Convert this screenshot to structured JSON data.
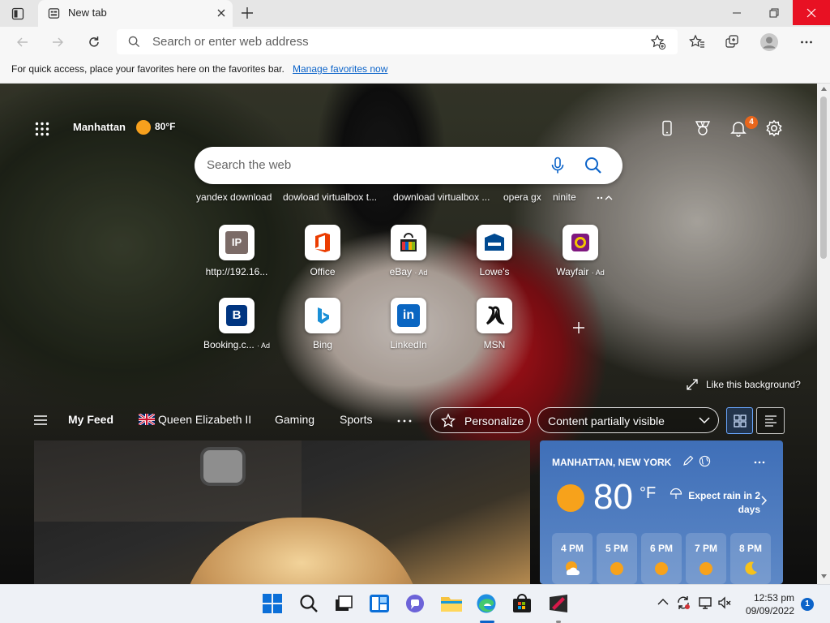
{
  "browser": {
    "tab_title": "New tab",
    "address_placeholder": "Search or enter web address"
  },
  "favorites_bar": {
    "message": "For quick access, place your favorites here on the favorites bar.",
    "link": "Manage favorites now"
  },
  "newtab": {
    "location": "Manhattan",
    "temperature": "80°F",
    "notification_count": "4",
    "search_placeholder": "Search the web",
    "recent_searches": [
      "yandex download",
      "dowload virtualbox t...",
      "download virtualbox ...",
      "opera gx",
      "ninite"
    ],
    "quick_links": [
      {
        "label": "http://192.16...",
        "ad": "",
        "icon": "ip-icon"
      },
      {
        "label": "Office",
        "ad": "",
        "icon": "office-icon"
      },
      {
        "label": "eBay",
        "ad": "· Ad",
        "icon": "ebay-icon"
      },
      {
        "label": "Lowe's",
        "ad": "",
        "icon": "lowes-icon"
      },
      {
        "label": "Wayfair",
        "ad": "· Ad",
        "icon": "wayfair-icon"
      },
      {
        "label": "Booking.c...",
        "ad": "· Ad",
        "icon": "booking-icon"
      },
      {
        "label": "Bing",
        "ad": "",
        "icon": "bing-icon"
      },
      {
        "label": "LinkedIn",
        "ad": "",
        "icon": "linkedin-icon"
      },
      {
        "label": "MSN",
        "ad": "",
        "icon": "msn-icon"
      }
    ],
    "like_background": "Like this background?"
  },
  "feed": {
    "items": [
      "My Feed",
      "Queen Elizabeth II",
      "Gaming",
      "Sports"
    ],
    "personalize": "Personalize",
    "visibility": "Content partially visible"
  },
  "weather": {
    "location": "MANHATTAN, NEW YORK",
    "temp": "80",
    "unit": "°F",
    "forecast": "Expect rain in 2 days",
    "hours": [
      {
        "time": "4 PM",
        "icon": "partly-cloudy-icon"
      },
      {
        "time": "5 PM",
        "icon": "sun-icon"
      },
      {
        "time": "6 PM",
        "icon": "sun-icon"
      },
      {
        "time": "7 PM",
        "icon": "sun-icon"
      },
      {
        "time": "8 PM",
        "icon": "moon-icon"
      }
    ]
  },
  "taskbar": {
    "time": "12:53 pm",
    "date": "09/09/2022",
    "notifications": "1"
  },
  "colors": {
    "accent": "#0b63c9",
    "close_red": "#e81123",
    "weather_card": "#4a78bd"
  }
}
